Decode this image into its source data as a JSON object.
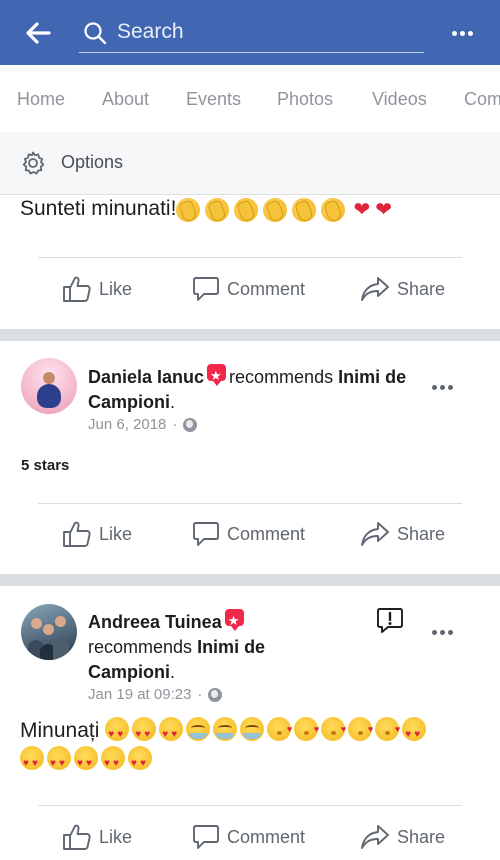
{
  "header": {
    "search_placeholder": "Search",
    "back_icon": "arrow-left-icon",
    "more_icon": "more-horizontal-icon",
    "bar_color": "#4267b2"
  },
  "tabs": [
    "Home",
    "About",
    "Events",
    "Photos",
    "Videos",
    "Com"
  ],
  "options": {
    "label": "Options",
    "icon": "gear-icon"
  },
  "post1": {
    "text": "Sunteti minunati!",
    "emoji": [
      "clapping-hands",
      "clapping-hands",
      "clapping-hands",
      "clapping-hands",
      "clapping-hands",
      "clapping-hands",
      "red-heart",
      "red-heart"
    ]
  },
  "actions": {
    "like": "Like",
    "comment": "Comment",
    "share": "Share"
  },
  "post2": {
    "author": "Daniela Ianuc",
    "verb": "recommends",
    "page": "Inimi de Campioni",
    "date": "Jun 6, 2018",
    "separator": "·",
    "rating": "5 stars"
  },
  "post3": {
    "author": "Andreea Tuinea",
    "verb": "recommends",
    "page": "Inimi de Campioni",
    "date": "Jan 19 at 09:23",
    "separator": "·",
    "text": "Minunați",
    "emoji_line1": [
      "heart-eyes",
      "heart-eyes",
      "heart-eyes",
      "tears-of-joy",
      "tears-of-joy",
      "tears-of-joy",
      "kissing-heart",
      "kissing-heart",
      "kissing-heart",
      "kissing-heart",
      "kissing-heart",
      "heart-eyes"
    ],
    "emoji_line2": [
      "heart-eyes",
      "heart-eyes",
      "heart-eyes",
      "heart-eyes",
      "heart-eyes"
    ]
  },
  "period": "."
}
